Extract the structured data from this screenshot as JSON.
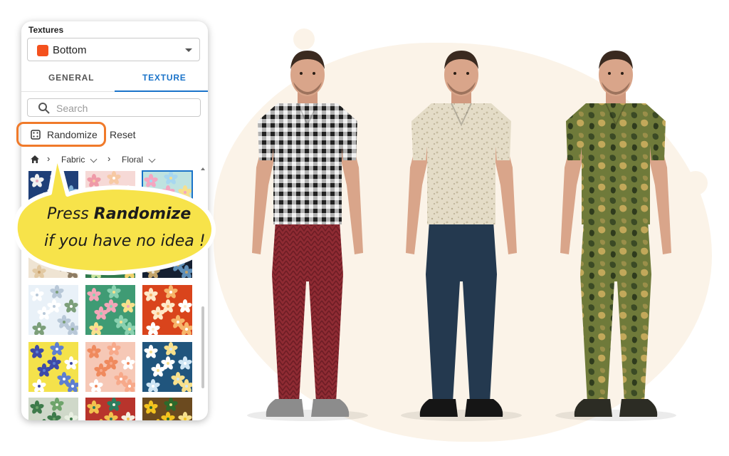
{
  "colors": {
    "accent_blue": "#1a73c9",
    "bottom_swatch": "#f4511e",
    "highlight_orange": "#f07a2a",
    "callout_yellow": "#f7e34a"
  },
  "panel": {
    "title": "Textures",
    "dropdown": {
      "value": "Bottom",
      "swatch_color": "#f4511e",
      "icon": "chevron-down-icon"
    },
    "tabs": [
      {
        "label": "GENERAL",
        "active": false
      },
      {
        "label": "TEXTURE",
        "active": true
      }
    ],
    "search": {
      "placeholder": "Search",
      "value": "",
      "icon": "search-icon"
    },
    "actions": {
      "randomize_label": "Randomize",
      "reset_label": "Reset",
      "randomize_icon": "dice-icon"
    },
    "breadcrumb": [
      {
        "label": "",
        "icon": "home-icon"
      },
      {
        "label": "Fabric"
      },
      {
        "label": "Floral"
      }
    ],
    "texture_tiles": [
      "floral-navy",
      "floral-pink",
      "floral-pastel",
      "floral-beige",
      "floral-leaf",
      "floral-dark",
      "floral-white-blue",
      "floral-tropical",
      "floral-orange",
      "floral-yellow",
      "floral-peach",
      "floral-teal-daisy",
      "leaf-green",
      "floral-multicolor",
      "floral-sunflower"
    ]
  },
  "callout": {
    "line1_prefix": "Press ",
    "line1_bold": "Randomize",
    "line2": "if you have no idea !"
  },
  "models": [
    {
      "shirt": "gingham black-white",
      "pants": "red knit"
    },
    {
      "shirt": "beige terrazzo",
      "pants": "navy solid"
    },
    {
      "shirt": "green camouflage",
      "pants": "green camouflage"
    }
  ]
}
